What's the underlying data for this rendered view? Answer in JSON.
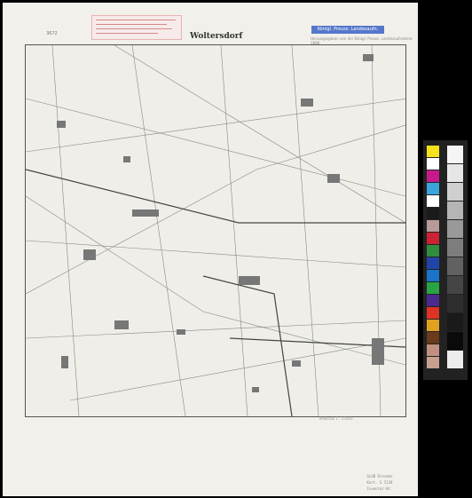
{
  "sheet": {
    "number": "3672",
    "title": "Woltersdorf",
    "label_strip": "Königl. Preuss. Landesaufn.",
    "printer_line": "Herausgegeben von der Königl. Preuss. Landesaufnahme 1888",
    "scale_text": "Maßstab 1 : 25000",
    "archive_stamp": [
      "SLUB Dresden",
      "Kart. S 5138",
      "Inventar-Nr."
    ]
  },
  "colors": {
    "paper": "#f1f0ea",
    "ink": "#555555",
    "stamp_red": "#d48a8a",
    "label_blue": "#5577cc"
  },
  "color_patches": [
    "#f5e21a",
    "#ffffff",
    "#c61a8c",
    "#3ba4dc",
    "#ffffff",
    "#1a1a1a",
    "#b89a9a",
    "#cc2233",
    "#2f8f3c",
    "#2244aa",
    "#1a74c8",
    "#28a444",
    "#4a2a8c",
    "#dd3322",
    "#e0a020",
    "#6a3a1a",
    "#c09080",
    "#c8a090"
  ],
  "grey_patches": [
    "#f5f5f5",
    "#e6e6e6",
    "#cfcfcf",
    "#b5b5b5",
    "#999999",
    "#7d7d7d",
    "#616161",
    "#454545",
    "#2e2e2e",
    "#1a1a1a",
    "#0a0a0a",
    "#ececec"
  ]
}
